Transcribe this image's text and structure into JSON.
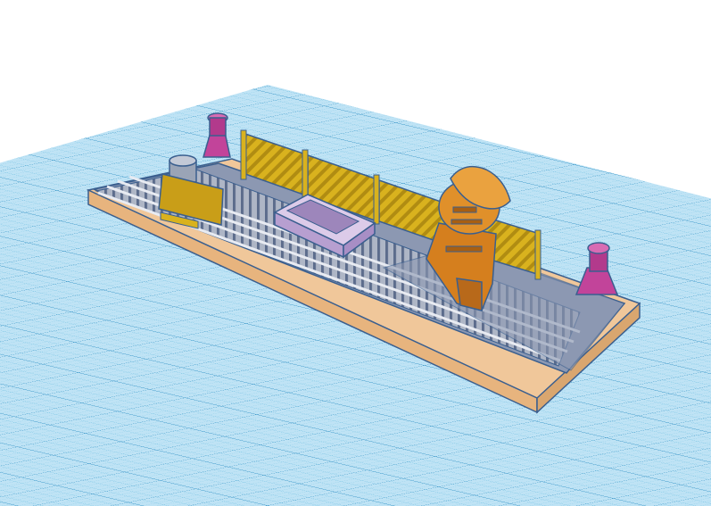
{
  "scene": {
    "background": "#ffffff",
    "workplane_color": "#bfe3f5",
    "grid_line_color": "#5fb3d9",
    "grid_major_color": "#2f8fc4",
    "base_color": "#f0c79a",
    "base_edge_color": "#3a5f8f",
    "rail_color": "#aeb6c6",
    "rail_dark": "#5c6c8c",
    "yellow_part": "#d9b21e",
    "orange_part": "#e0902a",
    "magenta_part": "#c2449a",
    "lilac_part": "#c8b4de",
    "objects": [
      {
        "name": "rail-base-plate",
        "icon": "base-plate-icon"
      },
      {
        "name": "track-rails",
        "icon": "rail-icon"
      },
      {
        "name": "yellow-fence-panels",
        "icon": "fence-icon"
      },
      {
        "name": "yellow-sign-board",
        "icon": "sign-icon"
      },
      {
        "name": "orange-totem-statue",
        "icon": "statue-icon"
      },
      {
        "name": "magenta-pillar-left",
        "icon": "pillar-icon"
      },
      {
        "name": "magenta-pillar-right",
        "icon": "pillar-icon"
      },
      {
        "name": "lilac-mine-cart",
        "icon": "cart-icon"
      },
      {
        "name": "grey-barrel",
        "icon": "barrel-icon"
      }
    ]
  }
}
